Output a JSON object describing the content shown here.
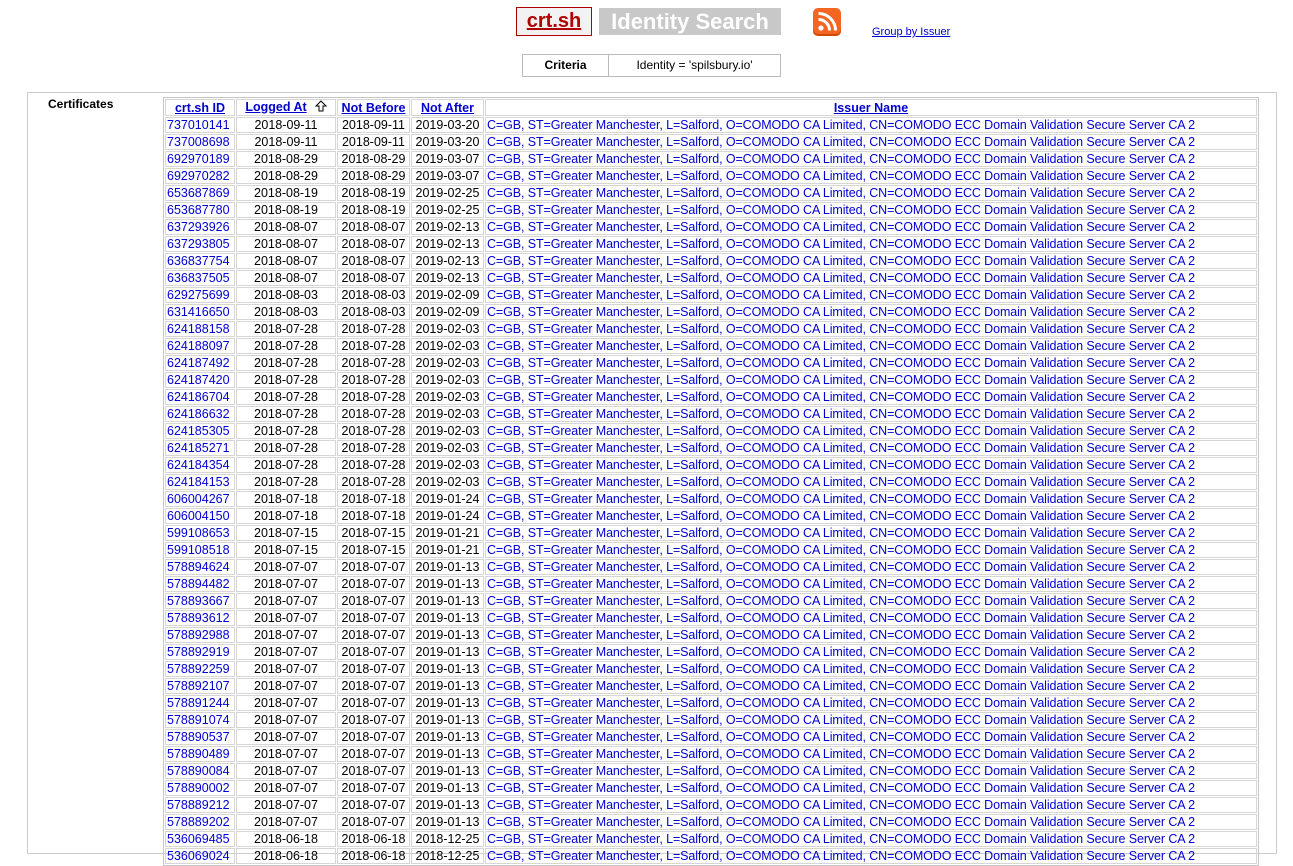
{
  "header": {
    "logo": "crt.sh",
    "title": "Identity Search",
    "group_link": "Group by Issuer"
  },
  "criteria": {
    "label": "Criteria",
    "value": "Identity = 'spilsbury.io'"
  },
  "certificates": {
    "section_label": "Certificates",
    "columns": [
      "crt.sh ID",
      "Logged At",
      "Not Before",
      "Not After",
      "Issuer Name"
    ],
    "sorted_column": "Logged At",
    "issuer_default": "C=GB, ST=Greater Manchester, L=Salford, O=COMODO CA Limited, CN=COMODO ECC Domain Validation Secure Server CA 2",
    "rows": [
      {
        "id": "737010141",
        "logged": "2018-09-11",
        "not_before": "2018-09-11",
        "not_after": "2019-03-20"
      },
      {
        "id": "737008698",
        "logged": "2018-09-11",
        "not_before": "2018-09-11",
        "not_after": "2019-03-20"
      },
      {
        "id": "692970189",
        "logged": "2018-08-29",
        "not_before": "2018-08-29",
        "not_after": "2019-03-07"
      },
      {
        "id": "692970282",
        "logged": "2018-08-29",
        "not_before": "2018-08-29",
        "not_after": "2019-03-07"
      },
      {
        "id": "653687869",
        "logged": "2018-08-19",
        "not_before": "2018-08-19",
        "not_after": "2019-02-25"
      },
      {
        "id": "653687780",
        "logged": "2018-08-19",
        "not_before": "2018-08-19",
        "not_after": "2019-02-25"
      },
      {
        "id": "637293926",
        "logged": "2018-08-07",
        "not_before": "2018-08-07",
        "not_after": "2019-02-13"
      },
      {
        "id": "637293805",
        "logged": "2018-08-07",
        "not_before": "2018-08-07",
        "not_after": "2019-02-13"
      },
      {
        "id": "636837754",
        "logged": "2018-08-07",
        "not_before": "2018-08-07",
        "not_after": "2019-02-13"
      },
      {
        "id": "636837505",
        "logged": "2018-08-07",
        "not_before": "2018-08-07",
        "not_after": "2019-02-13"
      },
      {
        "id": "629275699",
        "logged": "2018-08-03",
        "not_before": "2018-08-03",
        "not_after": "2019-02-09"
      },
      {
        "id": "631416650",
        "logged": "2018-08-03",
        "not_before": "2018-08-03",
        "not_after": "2019-02-09"
      },
      {
        "id": "624188158",
        "logged": "2018-07-28",
        "not_before": "2018-07-28",
        "not_after": "2019-02-03"
      },
      {
        "id": "624188097",
        "logged": "2018-07-28",
        "not_before": "2018-07-28",
        "not_after": "2019-02-03"
      },
      {
        "id": "624187492",
        "logged": "2018-07-28",
        "not_before": "2018-07-28",
        "not_after": "2019-02-03"
      },
      {
        "id": "624187420",
        "logged": "2018-07-28",
        "not_before": "2018-07-28",
        "not_after": "2019-02-03"
      },
      {
        "id": "624186704",
        "logged": "2018-07-28",
        "not_before": "2018-07-28",
        "not_after": "2019-02-03"
      },
      {
        "id": "624186632",
        "logged": "2018-07-28",
        "not_before": "2018-07-28",
        "not_after": "2019-02-03"
      },
      {
        "id": "624185305",
        "logged": "2018-07-28",
        "not_before": "2018-07-28",
        "not_after": "2019-02-03"
      },
      {
        "id": "624185271",
        "logged": "2018-07-28",
        "not_before": "2018-07-28",
        "not_after": "2019-02-03"
      },
      {
        "id": "624184354",
        "logged": "2018-07-28",
        "not_before": "2018-07-28",
        "not_after": "2019-02-03"
      },
      {
        "id": "624184153",
        "logged": "2018-07-28",
        "not_before": "2018-07-28",
        "not_after": "2019-02-03"
      },
      {
        "id": "606004267",
        "logged": "2018-07-18",
        "not_before": "2018-07-18",
        "not_after": "2019-01-24"
      },
      {
        "id": "606004150",
        "logged": "2018-07-18",
        "not_before": "2018-07-18",
        "not_after": "2019-01-24"
      },
      {
        "id": "599108653",
        "logged": "2018-07-15",
        "not_before": "2018-07-15",
        "not_after": "2019-01-21"
      },
      {
        "id": "599108518",
        "logged": "2018-07-15",
        "not_before": "2018-07-15",
        "not_after": "2019-01-21"
      },
      {
        "id": "578894624",
        "logged": "2018-07-07",
        "not_before": "2018-07-07",
        "not_after": "2019-01-13"
      },
      {
        "id": "578894482",
        "logged": "2018-07-07",
        "not_before": "2018-07-07",
        "not_after": "2019-01-13"
      },
      {
        "id": "578893667",
        "logged": "2018-07-07",
        "not_before": "2018-07-07",
        "not_after": "2019-01-13"
      },
      {
        "id": "578893612",
        "logged": "2018-07-07",
        "not_before": "2018-07-07",
        "not_after": "2019-01-13"
      },
      {
        "id": "578892988",
        "logged": "2018-07-07",
        "not_before": "2018-07-07",
        "not_after": "2019-01-13"
      },
      {
        "id": "578892919",
        "logged": "2018-07-07",
        "not_before": "2018-07-07",
        "not_after": "2019-01-13"
      },
      {
        "id": "578892259",
        "logged": "2018-07-07",
        "not_before": "2018-07-07",
        "not_after": "2019-01-13"
      },
      {
        "id": "578892107",
        "logged": "2018-07-07",
        "not_before": "2018-07-07",
        "not_after": "2019-01-13"
      },
      {
        "id": "578891244",
        "logged": "2018-07-07",
        "not_before": "2018-07-07",
        "not_after": "2019-01-13"
      },
      {
        "id": "578891074",
        "logged": "2018-07-07",
        "not_before": "2018-07-07",
        "not_after": "2019-01-13"
      },
      {
        "id": "578890537",
        "logged": "2018-07-07",
        "not_before": "2018-07-07",
        "not_after": "2019-01-13"
      },
      {
        "id": "578890489",
        "logged": "2018-07-07",
        "not_before": "2018-07-07",
        "not_after": "2019-01-13"
      },
      {
        "id": "578890084",
        "logged": "2018-07-07",
        "not_before": "2018-07-07",
        "not_after": "2019-01-13"
      },
      {
        "id": "578890002",
        "logged": "2018-07-07",
        "not_before": "2018-07-07",
        "not_after": "2019-01-13"
      },
      {
        "id": "578889212",
        "logged": "2018-07-07",
        "not_before": "2018-07-07",
        "not_after": "2019-01-13"
      },
      {
        "id": "578889202",
        "logged": "2018-07-07",
        "not_before": "2018-07-07",
        "not_after": "2019-01-13"
      },
      {
        "id": "536069485",
        "logged": "2018-06-18",
        "not_before": "2018-06-18",
        "not_after": "2018-12-25"
      },
      {
        "id": "536069024",
        "logged": "2018-06-18",
        "not_before": "2018-06-18",
        "not_after": "2018-12-25"
      }
    ]
  },
  "icons": {
    "rss": "rss-feed-icon",
    "sort": "sort-up-arrow-icon"
  },
  "colors": {
    "link": "#0000d0",
    "logo": "#b00000",
    "title_bg": "#c8c8c8",
    "rss": "#f26522"
  }
}
